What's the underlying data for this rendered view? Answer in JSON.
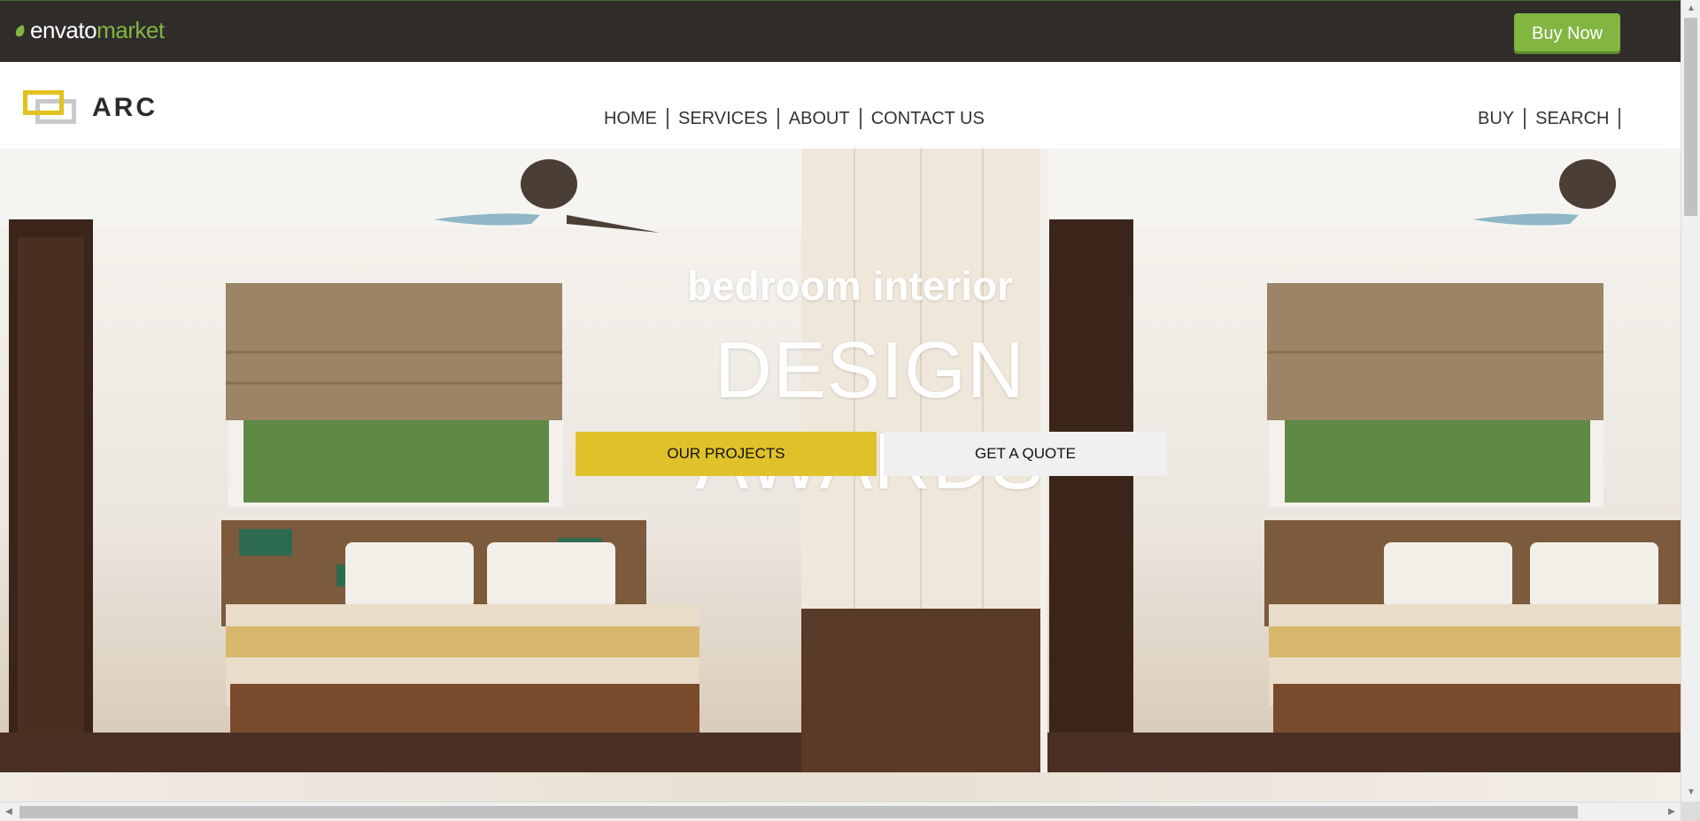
{
  "envato_bar": {
    "logo_word": "envato",
    "logo_market": "market",
    "buy_now_label": "Buy Now",
    "accent_color": "#82b541"
  },
  "site": {
    "logo_text": "ARC",
    "logo_colors": {
      "front": "#e2c21e",
      "back": "#c9c9c9"
    },
    "nav": [
      {
        "label": "HOME"
      },
      {
        "label": "SERVICES"
      },
      {
        "label": "ABOUT"
      },
      {
        "label": "CONTACT US"
      }
    ],
    "util_nav": [
      {
        "label": "BUY"
      },
      {
        "label": "SEARCH"
      }
    ]
  },
  "hero": {
    "subtitle": "bedroom interior",
    "title": "DESIGN AWARDS",
    "buttons": {
      "projects_label": "OUR PROJECTS",
      "quote_label": "GET A QUOTE"
    },
    "accent_color": "#dfc12a"
  },
  "icons": {
    "scroll_up": "▲",
    "scroll_down": "▼",
    "scroll_left": "◀",
    "scroll_right": "▶"
  }
}
